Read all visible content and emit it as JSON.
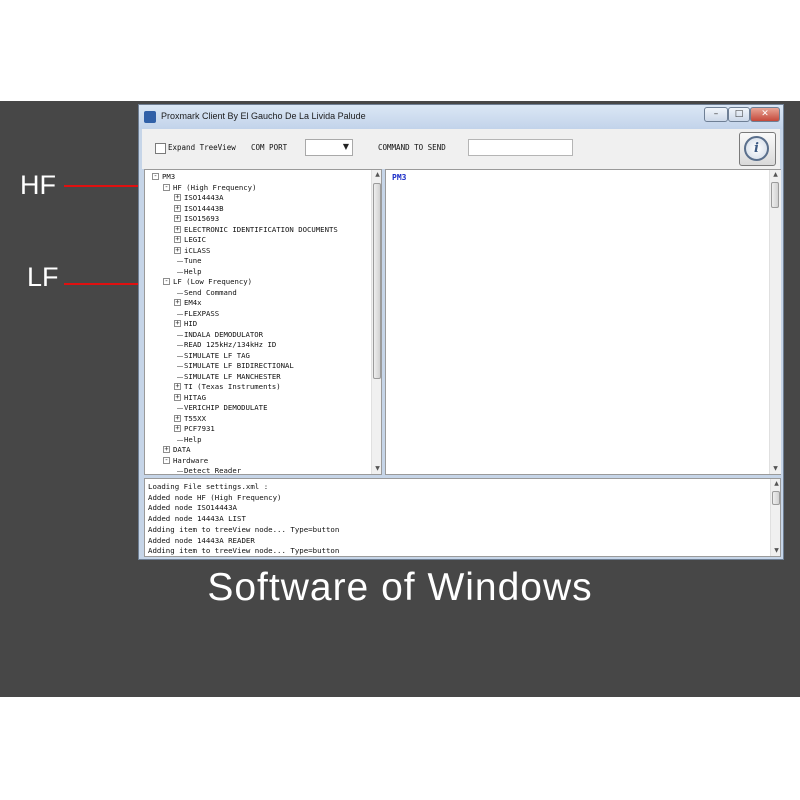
{
  "annotations": {
    "hf_label": "HF",
    "lf_label": "LF",
    "caption": "Software of Windows",
    "arrow_color": "#e01010"
  },
  "window": {
    "title": "Proxmark Client By El Gaucho De La Livida Palude",
    "controls": {
      "minimize": "–",
      "maximize": "□",
      "close": "✕"
    }
  },
  "toolbar": {
    "expand_label": "Expand TreeView",
    "expand_checked": false,
    "com_port_label": "COM PORT",
    "com_port_value": "",
    "command_label": "COMMAND TO SEND",
    "command_value": "",
    "info_icon": "info-icon"
  },
  "tree": [
    {
      "label": "PM3",
      "depth": 0,
      "expander": "-"
    },
    {
      "label": "HF (High Frequency)",
      "depth": 1,
      "expander": "-"
    },
    {
      "label": "ISO14443A",
      "depth": 2,
      "expander": "+"
    },
    {
      "label": "ISO14443B",
      "depth": 2,
      "expander": "+"
    },
    {
      "label": "ISO15693",
      "depth": 2,
      "expander": "+"
    },
    {
      "label": "ELECTRONIC IDENTIFICATION DOCUMENTS",
      "depth": 2,
      "expander": "+"
    },
    {
      "label": "LEGIC",
      "depth": 2,
      "expander": "+"
    },
    {
      "label": "iCLASS",
      "depth": 2,
      "expander": "+"
    },
    {
      "label": "Tune",
      "depth": 2,
      "expander": ""
    },
    {
      "label": "Help",
      "depth": 2,
      "expander": ""
    },
    {
      "label": "LF (Low Frequency)",
      "depth": 1,
      "expander": "-"
    },
    {
      "label": "Send Command",
      "depth": 2,
      "expander": ""
    },
    {
      "label": "EM4x",
      "depth": 2,
      "expander": "+"
    },
    {
      "label": "FLEXPASS",
      "depth": 2,
      "expander": ""
    },
    {
      "label": "HID",
      "depth": 2,
      "expander": "+"
    },
    {
      "label": "INDALA DEMODULATOR",
      "depth": 2,
      "expander": ""
    },
    {
      "label": "READ 125kHz/134kHz ID",
      "depth": 2,
      "expander": ""
    },
    {
      "label": "SIMULATE LF TAG",
      "depth": 2,
      "expander": ""
    },
    {
      "label": "SIMULATE LF BIDIRECTIONAL",
      "depth": 2,
      "expander": ""
    },
    {
      "label": "SIMULATE LF MANCHESTER",
      "depth": 2,
      "expander": ""
    },
    {
      "label": "TI (Texas Instruments)",
      "depth": 2,
      "expander": "+"
    },
    {
      "label": "HITAG",
      "depth": 2,
      "expander": "+"
    },
    {
      "label": "VERICHIP DEMODULATE",
      "depth": 2,
      "expander": ""
    },
    {
      "label": "T55XX",
      "depth": 2,
      "expander": "+"
    },
    {
      "label": "PCF7931",
      "depth": 2,
      "expander": "+"
    },
    {
      "label": "Help",
      "depth": 2,
      "expander": ""
    },
    {
      "label": "DATA",
      "depth": 1,
      "expander": "+"
    },
    {
      "label": "Hardware",
      "depth": 1,
      "expander": "-"
    },
    {
      "label": "Detect Reader",
      "depth": 2,
      "expander": ""
    }
  ],
  "output": {
    "title": "PM3"
  },
  "log": [
    "Loading File settings.xml :",
    "Added node HF (High Frequency)",
    "Added node ISO14443A",
    "Added node 14443A LIST",
    "Adding item to treeView node... Type=button",
    "Added node 14443A READER",
    "Adding item to treeView node... Type=button"
  ]
}
